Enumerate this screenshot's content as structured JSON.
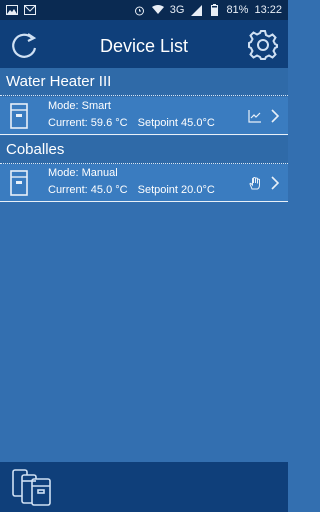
{
  "status_bar": {
    "battery": "81%",
    "time": "13:22",
    "network": "3G",
    "left_icons": [
      "image-icon",
      "gmail-icon"
    ],
    "right_icons": [
      "alarm-icon",
      "wifi-icon",
      "signal-icon",
      "battery-icon"
    ]
  },
  "header": {
    "title": "Device List",
    "left_icon": "refresh-icon",
    "right_icon": "settings-gear-icon"
  },
  "groups": [
    {
      "name": "Water Heater III",
      "device": {
        "mode": "Mode: Smart",
        "current": "Current: 59.6 °C",
        "setpoint": "Setpoint 45.0°C",
        "status_icon": "chart-icon"
      }
    },
    {
      "name": "Coballes",
      "device": {
        "mode": "Mode: Manual",
        "current": "Current: 45.0 °C",
        "setpoint": "Setpoint 20.0°C",
        "status_icon": "hand-icon"
      }
    }
  ],
  "bottom_bar": {
    "icon": "devices-icon"
  },
  "colors": {
    "status_bar": "#0a2a52",
    "header": "#0f3f7a",
    "background": "#336fb0",
    "device_row": "#3a7cc0",
    "text": "#ffffff"
  }
}
